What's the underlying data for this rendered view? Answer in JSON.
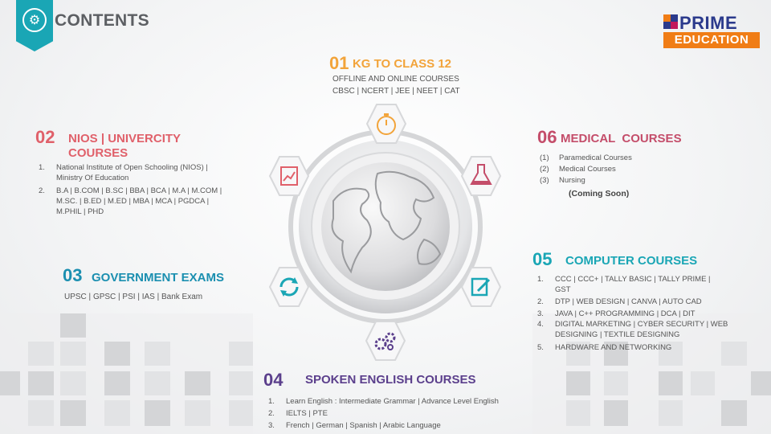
{
  "header": {
    "title": "CONTENTS"
  },
  "logo": {
    "prime": "PRIME",
    "education": "EDUCATION"
  },
  "colors": {
    "teal": "#1aa6b5",
    "orange": "#f2a43a",
    "red": "#e0606a",
    "rose": "#c44d6a",
    "blue": "#1b8fb0",
    "navy": "#2b3a8c",
    "purple": "#5b3f8c"
  },
  "sections": {
    "s01": {
      "num": "01",
      "title": "KG TO CLASS 12",
      "line1": "OFFLINE AND ONLINE COURSES",
      "line2": "CBSC | NCERT | JEE | NEET | CAT"
    },
    "s02": {
      "num": "02",
      "title1": "NIOS | UNIVERCITY",
      "title2": "COURSES",
      "items": [
        {
          "n": "1.",
          "l1": "National Institute of Open Schooling (NIOS) |",
          "l2": "Ministry Of Education",
          "l3": ""
        },
        {
          "n": "2.",
          "l1": "B.A | B.COM | B.SC | BBA | BCA | M.A | M.COM |",
          "l2": "M.SC. | B.ED | M.ED | MBA | MCA | PGDCA |",
          "l3": "M.PHIL | PHD"
        }
      ]
    },
    "s03": {
      "num": "03",
      "title": "GOVERNMENT EXAMS",
      "line1": "UPSC | GPSC | PSI | IAS | Bank Exam"
    },
    "s04": {
      "num": "04",
      "title": "SPOKEN ENGLISH COURSES",
      "items": [
        {
          "n": "1.",
          "l1": "Learn English : Intermediate Grammar | Advance Level English"
        },
        {
          "n": "2.",
          "l1": "IELTS | PTE"
        },
        {
          "n": "3.",
          "l1": "French | German | Spanish | Arabic Language"
        }
      ]
    },
    "s05": {
      "num": "05",
      "title": "COMPUTER COURSES",
      "items": [
        {
          "n": "1.",
          "l1": "CCC | CCC+ | TALLY BASIC | TALLY PRIME |",
          "l2": "GST"
        },
        {
          "n": "2.",
          "l1": "DTP | WEB DESIGN | CANVA | AUTO CAD",
          "l2": ""
        },
        {
          "n": "3.",
          "l1": "JAVA | C++ PROGRAMMING | DCA | DIT",
          "l2": ""
        },
        {
          "n": "4.",
          "l1": "DIGITAL MARKETING | CYBER SECURITY | WEB",
          "l2": "DESIGNING | TEXTILE DESIGNING"
        },
        {
          "n": "5.",
          "l1": "HARDWARE AND NETWORKING",
          "l2": ""
        }
      ]
    },
    "s06": {
      "num": "06",
      "title": "MEDICAL  COURSES",
      "items": [
        {
          "n": "(1)",
          "l1": "Paramedical Courses"
        },
        {
          "n": "(2)",
          "l1": "Medical Courses"
        },
        {
          "n": "(3)",
          "l1": "Nursing"
        }
      ],
      "note": "(Coming Soon)"
    }
  },
  "icons": [
    "stopwatch-icon",
    "flask-icon",
    "edit-icon",
    "gears-icon",
    "refresh-icon",
    "chart-icon",
    "globe-icon"
  ]
}
